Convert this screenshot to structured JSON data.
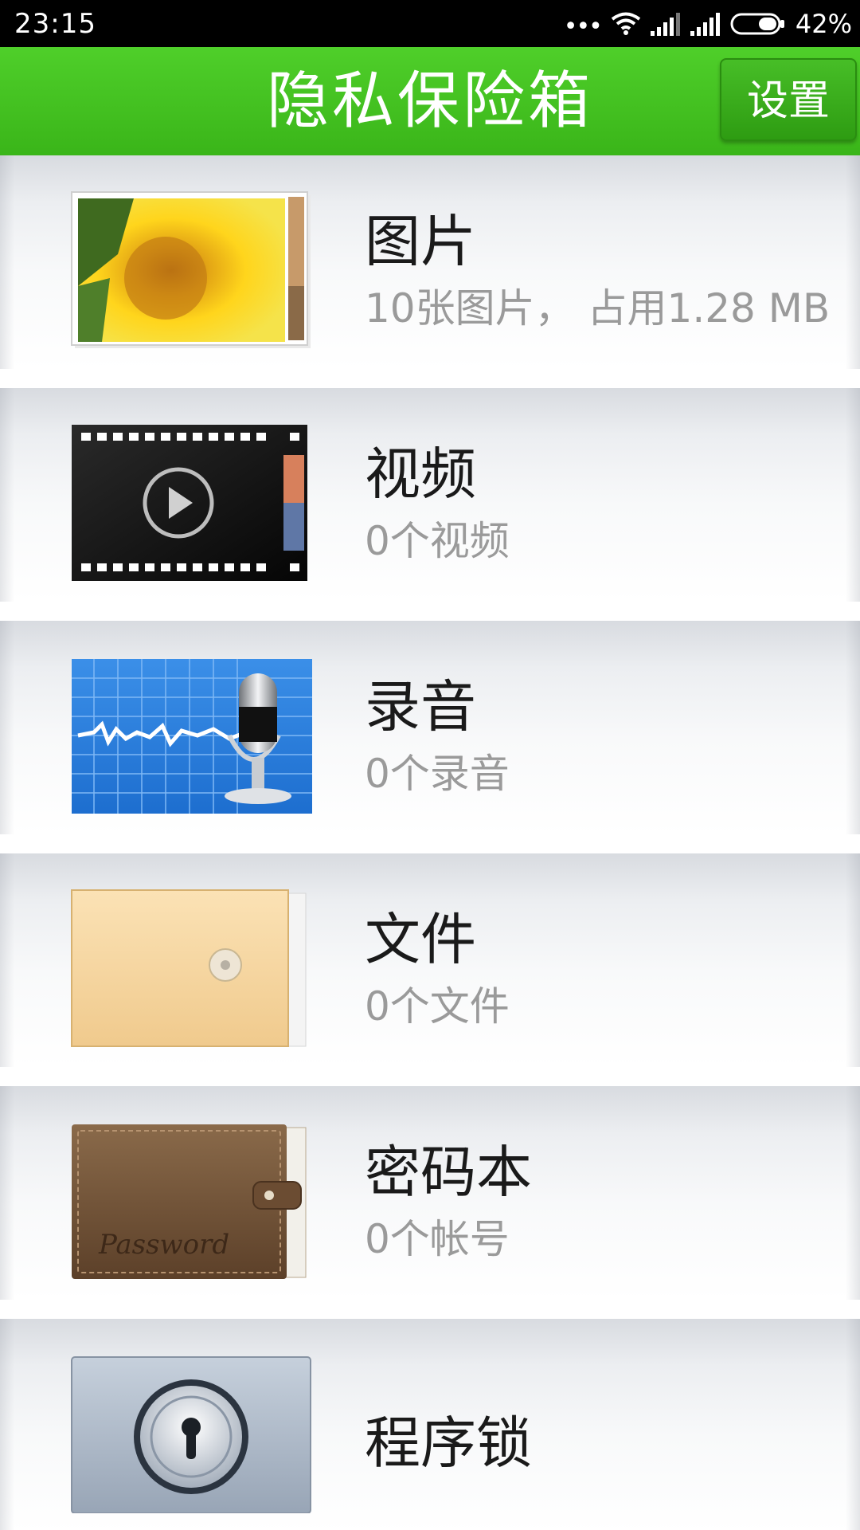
{
  "status_bar": {
    "time": "23:15",
    "battery": "42%",
    "icons": [
      "more-dots-icon",
      "wifi-icon",
      "signal-icon",
      "signal-icon",
      "battery-icon"
    ]
  },
  "header": {
    "title": "隐私保险箱",
    "settings_label": "设置",
    "color": "#45c422"
  },
  "items": [
    {
      "title": "图片",
      "subtitle": "10张图片， 占用1.28 MB",
      "icon": "photos-icon"
    },
    {
      "title": "视频",
      "subtitle": "0个视频",
      "icon": "video-icon"
    },
    {
      "title": "录音",
      "subtitle": "0个录音",
      "icon": "recording-icon"
    },
    {
      "title": "文件",
      "subtitle": "0个文件",
      "icon": "envelope-icon"
    },
    {
      "title": "密码本",
      "subtitle": "0个帐号",
      "icon": "password-wallet-icon",
      "icon_text": "Password"
    },
    {
      "title": "程序锁",
      "icon": "app-lock-icon"
    }
  ]
}
